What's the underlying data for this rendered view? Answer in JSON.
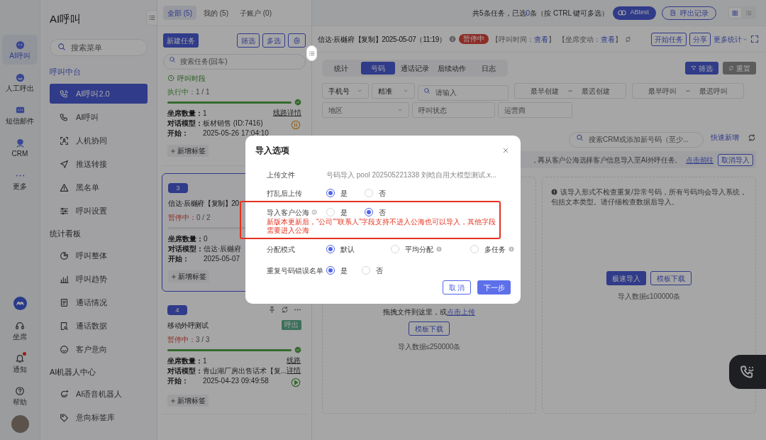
{
  "rail": {
    "items": [
      {
        "label": "AI呼叫",
        "selected": true
      },
      {
        "label": "人工呼出",
        "selected": false
      },
      {
        "label": "短信邮件",
        "selected": false
      },
      {
        "label": "CRM",
        "selected": false
      },
      {
        "label": "更多",
        "selected": false
      }
    ],
    "bottom": [
      {
        "label": "坐席",
        "badge": false
      },
      {
        "label": "通知",
        "badge": true
      },
      {
        "label": "帮助",
        "badge": false
      }
    ]
  },
  "sidebar": {
    "title": "AI呼叫",
    "search_placeholder": "搜索菜单",
    "groups": [
      {
        "heading": "呼叫中台",
        "active": true,
        "items": [
          {
            "label": "AI呼叫2.0",
            "selected": true
          },
          {
            "label": "AI呼叫",
            "selected": false
          },
          {
            "label": "人机协同",
            "selected": false
          },
          {
            "label": "推送转接",
            "selected": false
          },
          {
            "label": "黑名单",
            "selected": false
          },
          {
            "label": "呼叫设置",
            "selected": false
          }
        ]
      },
      {
        "heading": "统计看板",
        "active": false,
        "items": [
          {
            "label": "呼叫整体",
            "selected": false
          },
          {
            "label": "呼叫趋势",
            "selected": false
          },
          {
            "label": "通话情况",
            "selected": false
          },
          {
            "label": "通话数据",
            "selected": false
          },
          {
            "label": "客户意向",
            "selected": false
          }
        ]
      },
      {
        "heading": "AI机器人中心",
        "active": false,
        "items": [
          {
            "label": "AI语音机器人",
            "selected": false
          },
          {
            "label": "意向标签库",
            "selected": false
          }
        ]
      }
    ]
  },
  "task_list": {
    "tabs": [
      {
        "label": "全部 (5)",
        "selected": true
      },
      {
        "label": "我的 (5)",
        "selected": false
      },
      {
        "label": "子账户 (0)",
        "selected": false
      }
    ],
    "new_button": "新建任务",
    "filter_button": "筛选",
    "multi_button": "多选",
    "search_placeholder": "搜索任务(回车)",
    "cards": [
      {
        "selected": false,
        "time_slot": "呼叫时段",
        "status": {
          "kind": "running",
          "label": "执行中：",
          "count": "1 / 1"
        },
        "progress": {
          "level": 1
        },
        "fields": [
          {
            "label": "坐席数量：",
            "value": "1"
          },
          {
            "label": "对话模型：",
            "value": "板材销售 (ID:7416)"
          },
          {
            "label": "开始：",
            "value": "2025-05-26 17:04:10"
          }
        ],
        "line_link": "线路详情",
        "action": {
          "kind": "pause"
        },
        "add_tag": "新增标签"
      },
      {
        "selected": true,
        "badge": "3",
        "title": "信达·辰樾府【复制】20",
        "status": {
          "kind": "paused",
          "label": "暂停中：",
          "count": "0 / 2"
        },
        "progress": {
          "level": 0
        },
        "fields": [
          {
            "label": "坐席数量：",
            "value": "0"
          },
          {
            "label": "对话模型：",
            "value": "信达·辰樾府"
          },
          {
            "label": "开始：",
            "value": "2025-05-07"
          }
        ],
        "add_tag": "新增标签"
      },
      {
        "selected": false,
        "badge": "4",
        "tools": true,
        "title": "移动外呼测试",
        "tag": "呼出",
        "status": {
          "kind": "paused",
          "label": "暂停中：",
          "count": "3 / 3"
        },
        "progress": {
          "level": 1
        },
        "fields": [
          {
            "label": "坐席数量：",
            "value": "1"
          },
          {
            "label": "对话模型：",
            "value": "青山湖厂房出售话术【复..."
          },
          {
            "label": "开始：",
            "value": "2025-04-23 09:49:58"
          }
        ],
        "line_link": "线路详情",
        "action": {
          "kind": "play"
        },
        "add_tag": "新增标签"
      }
    ]
  },
  "topbar": {
    "summary_prefix": "共5条任务，已选",
    "selected_count": "0",
    "summary_suffix": "条（按 CTRL 键可多选）",
    "abtest": "ABtest",
    "call_log": "呼出记录",
    "views": [
      {
        "selected": true
      },
      {
        "selected": false
      }
    ]
  },
  "task_header": {
    "title": "信达·辰樾府【复制】2025-05-07（11:19）",
    "status": "暂停中",
    "links": [
      {
        "prefix": "【呼叫时间：",
        "link": "查看",
        "suffix": "】"
      },
      {
        "prefix": "【坐席变动：",
        "link": "查看",
        "suffix": "】"
      }
    ],
    "actions": [
      "开始任务",
      "分享"
    ],
    "more": "更多统计"
  },
  "tabs": [
    {
      "label": "统计",
      "selected": false
    },
    {
      "label": "号码",
      "selected": true
    },
    {
      "label": "通话记录",
      "selected": false
    },
    {
      "label": "后续动作",
      "selected": false
    },
    {
      "label": "日志",
      "selected": false
    }
  ],
  "filter_button": "筛选",
  "reset_button": "重置",
  "filters": [
    [
      {
        "kind": "select",
        "value": "手机号"
      },
      {
        "kind": "select",
        "value": "精准"
      },
      {
        "kind": "search",
        "placeholder": "请输入"
      },
      {
        "kind": "range",
        "from": "最早创建",
        "to": "最迟创建"
      },
      {
        "kind": "range",
        "from": "最早呼叫",
        "to": "最迟呼叫"
      }
    ],
    [
      {
        "kind": "select",
        "placeholder": "地区"
      },
      {
        "kind": "input",
        "placeholder": "呼叫状态"
      },
      {
        "kind": "input",
        "placeholder": "运营商"
      }
    ]
  ],
  "crm_search": {
    "placeholder": "搜索CRM或添加新号码（至少...",
    "quick_add": "快速新增"
  },
  "notice": {
    "text": "，再从客户公海选择客户信息导入至AI外呼任务。",
    "link": "点击前往",
    "cancel": "取消导入"
  },
  "upload_panels": [
    {
      "kind": "dropzone",
      "hint": "拖拽文件到这里，或",
      "link": "点击上传",
      "buttons": [
        {
          "label": "模板下载",
          "primary": false
        }
      ],
      "limit": "导入数据≤250000条"
    },
    {
      "kind": "fast",
      "warning": "该导入形式不检查重复/异常号码，所有号码均会导入系统，包括文本类型。请仔细检查数据后导入。",
      "buttons": [
        {
          "label": "极速导入",
          "primary": true
        },
        {
          "label": "模板下载",
          "primary": false
        }
      ],
      "limit": "导入数据≤100000条"
    }
  ],
  "dialog": {
    "title": "导入选项",
    "rows": [
      {
        "kind": "text",
        "label": "上传文件",
        "value": "号码导入 pool 202505221338 刘晗自用大模型测试.x..."
      },
      {
        "kind": "radio",
        "label": "打乱后上传",
        "options": [
          {
            "label": "是",
            "selected": true
          },
          {
            "label": "否",
            "selected": false
          }
        ]
      },
      {
        "kind": "radio",
        "label": "导入客户公海",
        "info": true,
        "options": [
          {
            "label": "是",
            "selected": false
          },
          {
            "label": "否",
            "selected": true
          }
        ],
        "note": "新版本更新后，“公司”“联系人”字段支持不进入公海也可以导入，其他字段需要进入公海"
      },
      {
        "kind": "radio",
        "label": "分配模式",
        "options": [
          {
            "label": "默认",
            "selected": true
          },
          {
            "label": "平均分配",
            "selected": false,
            "info": true
          },
          {
            "label": "多任务",
            "selected": false,
            "info": true
          }
        ]
      },
      {
        "kind": "radio",
        "label": "重复号码错误名单",
        "options": [
          {
            "label": "是",
            "selected": true
          },
          {
            "label": "否",
            "selected": false
          }
        ]
      }
    ],
    "cancel": "取 消",
    "next": "下一步"
  }
}
